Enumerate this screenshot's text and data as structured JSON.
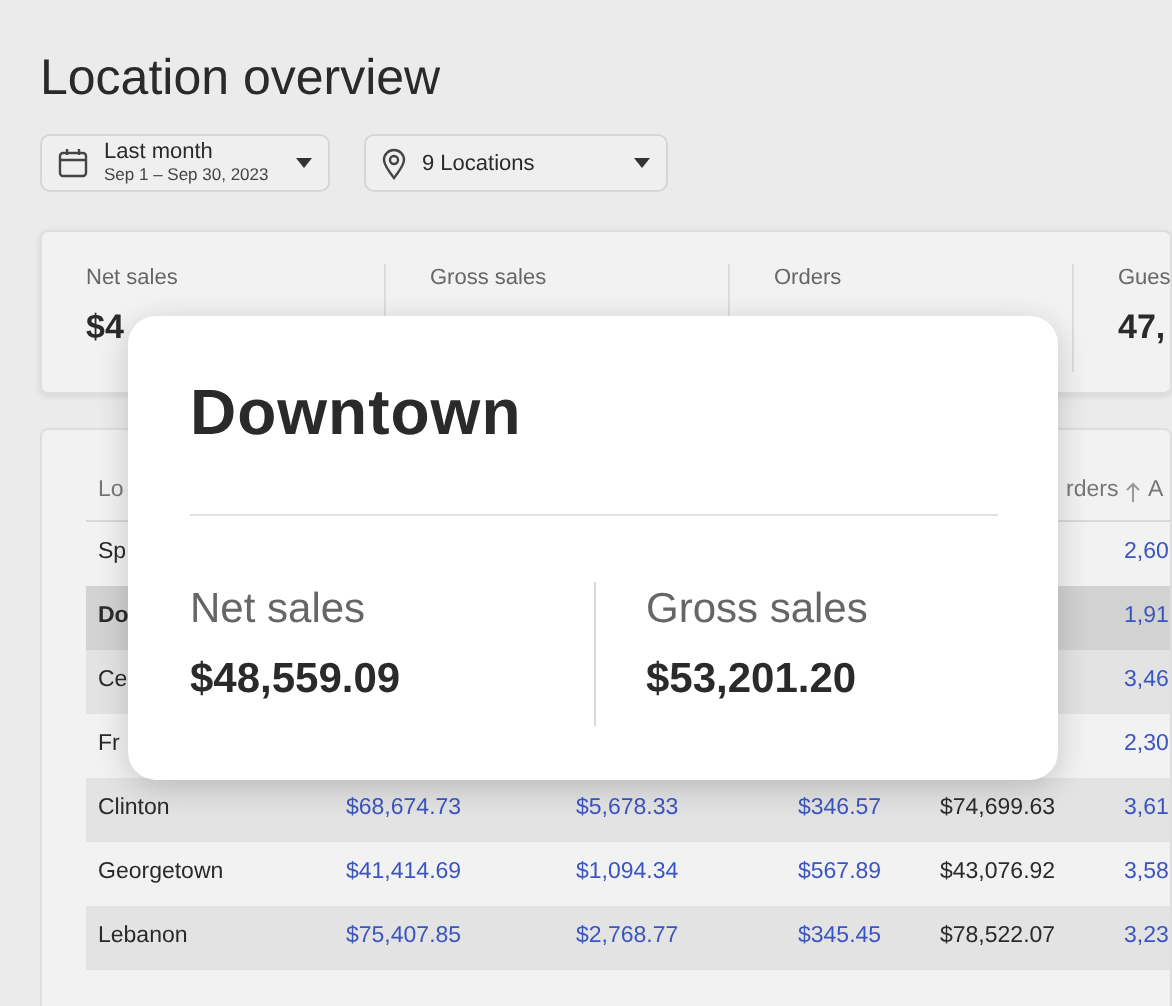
{
  "title": "Location overview",
  "filters": [
    {
      "kind": "date",
      "label": "Last month",
      "sublabel": "Sep 1 – Sep 30, 2023"
    },
    {
      "kind": "location",
      "label": "9 Locations"
    }
  ],
  "stats": [
    {
      "label": "Net sales",
      "value": "$4"
    },
    {
      "label": "Gross sales"
    },
    {
      "label": "Orders"
    },
    {
      "label": "Gues",
      "value": "47,"
    }
  ],
  "table": {
    "columns": [
      {
        "label": "Lo",
        "kind": "text"
      },
      {
        "kind": "link"
      },
      {
        "kind": "link"
      },
      {
        "kind": "link"
      },
      {
        "label": "rders",
        "kind": "text",
        "sorted": true
      },
      {
        "label": "A",
        "kind": "link"
      }
    ],
    "rows": [
      {
        "cells": [
          "Sp",
          null,
          null,
          null,
          null,
          "2,60"
        ],
        "selected": false
      },
      {
        "cells": [
          "Do",
          null,
          null,
          null,
          null,
          "1,91"
        ],
        "selected": true
      },
      {
        "cells": [
          "Ce",
          null,
          null,
          null,
          null,
          "3,46"
        ],
        "selected": false
      },
      {
        "cells": [
          "Fr",
          null,
          null,
          null,
          null,
          "2,30"
        ],
        "selected": false
      },
      {
        "cells": [
          "Clinton",
          "$68,674.73",
          "$5,678.33",
          "$346.57",
          "$74,699.63",
          "3,61"
        ],
        "selected": false
      },
      {
        "cells": [
          "Georgetown",
          "$41,414.69",
          "$1,094.34",
          "$567.89",
          "$43,076.92",
          "3,58"
        ],
        "selected": false
      },
      {
        "cells": [
          "Lebanon",
          "$75,407.85",
          "$2,768.77",
          "$345.45",
          "$78,522.07",
          "3,23"
        ],
        "selected": false
      }
    ]
  },
  "popup": {
    "title": "Downtown",
    "metrics": [
      {
        "label": "Net sales",
        "value": "$48,559.09"
      },
      {
        "label": "Gross sales",
        "value": "$53,201.20"
      }
    ]
  }
}
